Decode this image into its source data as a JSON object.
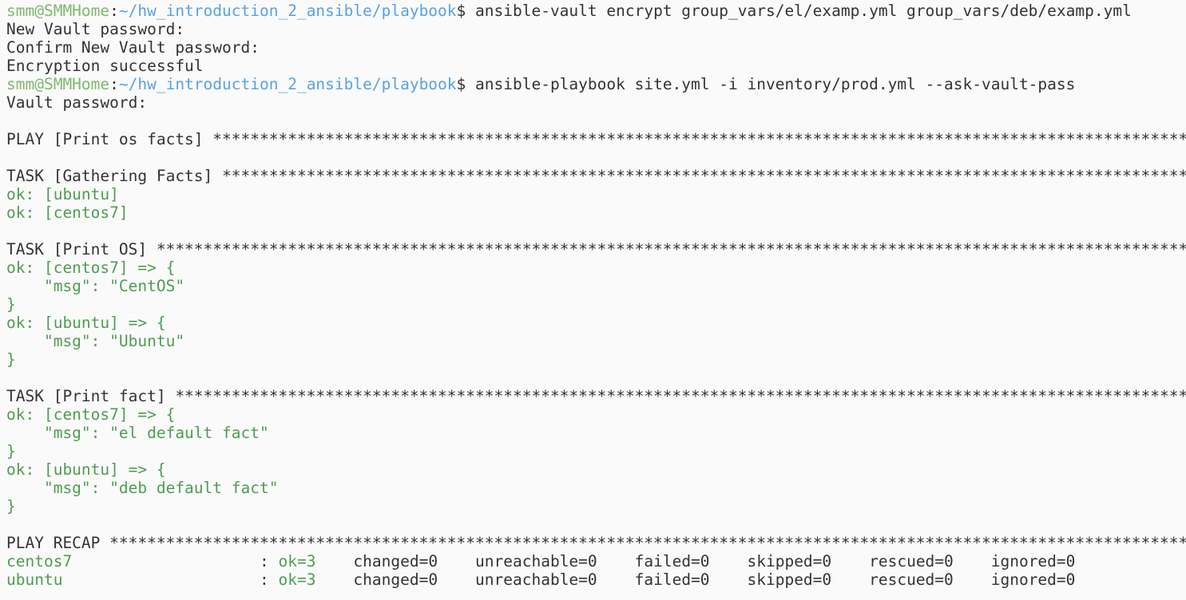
{
  "colors": {
    "background": "#fafafa",
    "text": "#333333",
    "prompt_user": "#7fb86f",
    "prompt_path": "#5aa2e0",
    "ok_green": "#4e9d50"
  },
  "prompt": {
    "user_host": "smm@SMMHome",
    "separator": ":",
    "path": "~/hw_introduction_2_ansible/playbook",
    "symbol": "$"
  },
  "lines": [
    {
      "type": "prompt",
      "command": " ansible-vault encrypt group_vars/el/examp.yml group_vars/deb/examp.yml"
    },
    {
      "type": "text",
      "text": "New Vault password:"
    },
    {
      "type": "text",
      "text": "Confirm New Vault password:"
    },
    {
      "type": "text",
      "text": "Encryption successful"
    },
    {
      "type": "prompt",
      "command": " ansible-playbook site.yml -i inventory/prod.yml --ask-vault-pass"
    },
    {
      "type": "text",
      "text": "Vault password:"
    },
    {
      "type": "text",
      "text": ""
    },
    {
      "type": "text",
      "text": "PLAY [Print os facts] ***********************************************************************************************************"
    },
    {
      "type": "text",
      "text": ""
    },
    {
      "type": "text",
      "text": "TASK [Gathering Facts] **********************************************************************************************************"
    },
    {
      "type": "ok",
      "text": "ok: [ubuntu]"
    },
    {
      "type": "ok",
      "text": "ok: [centos7]"
    },
    {
      "type": "text",
      "text": ""
    },
    {
      "type": "text",
      "text": "TASK [Print OS] *****************************************************************************************************************"
    },
    {
      "type": "ok",
      "text": "ok: [centos7] => {"
    },
    {
      "type": "ok",
      "text": "    \"msg\": \"CentOS\""
    },
    {
      "type": "ok",
      "text": "}"
    },
    {
      "type": "ok",
      "text": "ok: [ubuntu] => {"
    },
    {
      "type": "ok",
      "text": "    \"msg\": \"Ubuntu\""
    },
    {
      "type": "ok",
      "text": "}"
    },
    {
      "type": "text",
      "text": ""
    },
    {
      "type": "text",
      "text": "TASK [Print fact] ***************************************************************************************************************"
    },
    {
      "type": "ok",
      "text": "ok: [centos7] => {"
    },
    {
      "type": "ok",
      "text": "    \"msg\": \"el default fact\""
    },
    {
      "type": "ok",
      "text": "}"
    },
    {
      "type": "ok",
      "text": "ok: [ubuntu] => {"
    },
    {
      "type": "ok",
      "text": "    \"msg\": \"deb default fact\""
    },
    {
      "type": "ok",
      "text": "}"
    },
    {
      "type": "text",
      "text": ""
    },
    {
      "type": "text",
      "text": "PLAY RECAP **********************************************************************************************************************"
    },
    {
      "type": "recap",
      "host": "centos7                   ",
      "sep": " : ",
      "ok": "ok=3",
      "rest": "    changed=0    unreachable=0    failed=0    skipped=0    rescued=0    ignored=0"
    },
    {
      "type": "recap",
      "host": "ubuntu                    ",
      "sep": " : ",
      "ok": "ok=3",
      "rest": "    changed=0    unreachable=0    failed=0    skipped=0    rescued=0    ignored=0"
    }
  ]
}
